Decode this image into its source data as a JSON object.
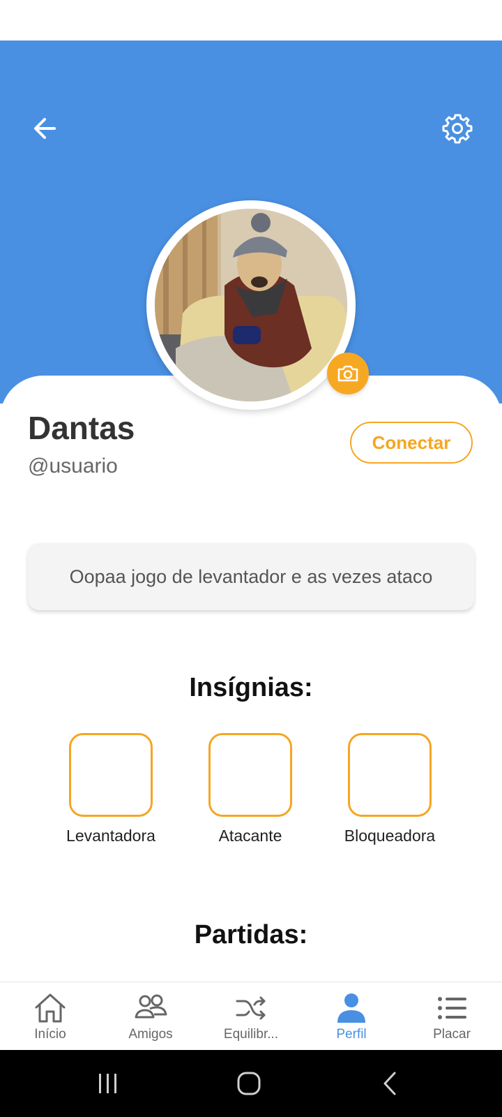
{
  "header": {
    "back_icon": "arrow-left-icon",
    "settings_icon": "gear-icon",
    "background_color": "#4a90e2"
  },
  "profile": {
    "name": "Dantas",
    "username": "@usuario",
    "connect_label": "Conectar",
    "camera_icon": "camera-icon",
    "bio": "Oopaa jogo de levantador e as vezes ataco",
    "accent_color": "#f5a623"
  },
  "badges": {
    "title": "Insígnias:",
    "items": [
      {
        "label": "Levantadora"
      },
      {
        "label": "Atacante"
      },
      {
        "label": "Bloqueadora"
      }
    ]
  },
  "matches": {
    "title": "Partidas:"
  },
  "bottom_nav": {
    "items": [
      {
        "label": "Início",
        "icon": "home-icon"
      },
      {
        "label": "Amigos",
        "icon": "friends-icon"
      },
      {
        "label": "Equilibr...",
        "icon": "shuffle-icon"
      },
      {
        "label": "Perfil",
        "icon": "person-icon",
        "active": true
      },
      {
        "label": "Placar",
        "icon": "list-icon"
      }
    ],
    "active_color": "#4a90e2"
  },
  "system_nav": [
    "recents-icon",
    "home-circle-icon",
    "back-chevron-icon"
  ]
}
